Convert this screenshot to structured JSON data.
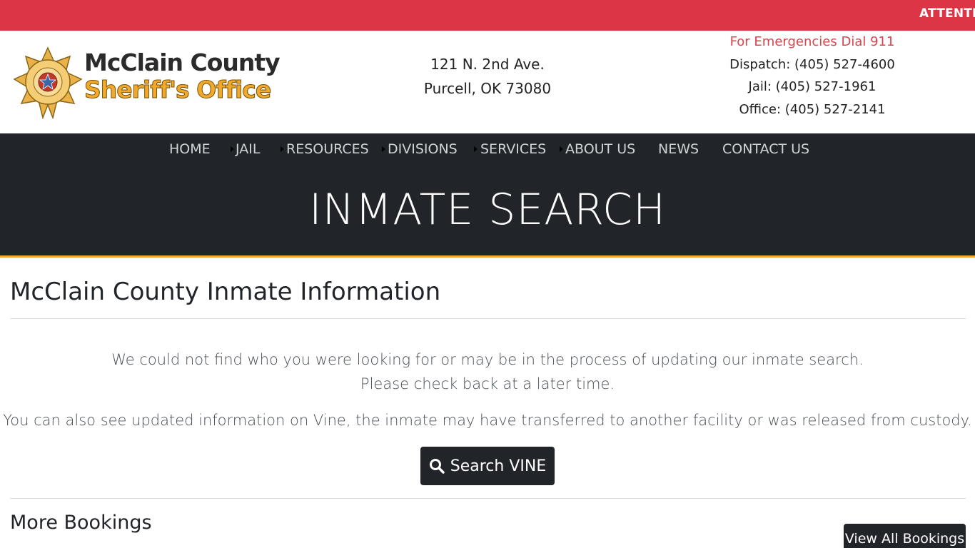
{
  "alert": {
    "text": "ATTENTION"
  },
  "brand": {
    "line1": "McClain County",
    "line2": "Sheriff's Office",
    "seal_text": "McCLAIN COUNTY SHERIFF'S OFFICE",
    "seal_top": "OKLAHOMA",
    "seal_bottom": "MCSO"
  },
  "address": {
    "line1": "121 N. 2nd Ave.",
    "line2": "Purcell, OK 73080"
  },
  "contacts": {
    "emergency": "For Emergencies Dial 911",
    "dispatch": "Dispatch: (405) 527-4600",
    "jail": "Jail: (405) 527-1961",
    "office": "Office: (405) 527-2141"
  },
  "nav": {
    "items": [
      {
        "label": "HOME"
      },
      {
        "label": "JAIL"
      },
      {
        "label": "RESOURCES"
      },
      {
        "label": "DIVISIONS"
      },
      {
        "label": "SERVICES"
      },
      {
        "label": "ABOUT US"
      },
      {
        "label": "NEWS"
      },
      {
        "label": "CONTACT US"
      }
    ]
  },
  "hero": {
    "title": "INMATE SEARCH"
  },
  "main": {
    "title": "McClain County Inmate Information",
    "message_line1": "We could not find who you were looking for or may be in the process of updating our inmate search.",
    "message_line2": "Please check back at a later time.",
    "message_line3": "You can also see updated information on Vine, the inmate may have transferred to another facility or was released from custody.",
    "vine_button": "Search VINE",
    "vine_icon": "search-icon"
  },
  "bookings": {
    "title": "More Bookings",
    "view_all": "View All Bookings"
  },
  "colors": {
    "alert": "#dc3545",
    "dark": "#212529",
    "accent": "#f0a92c",
    "emergency": "#d9434c"
  }
}
